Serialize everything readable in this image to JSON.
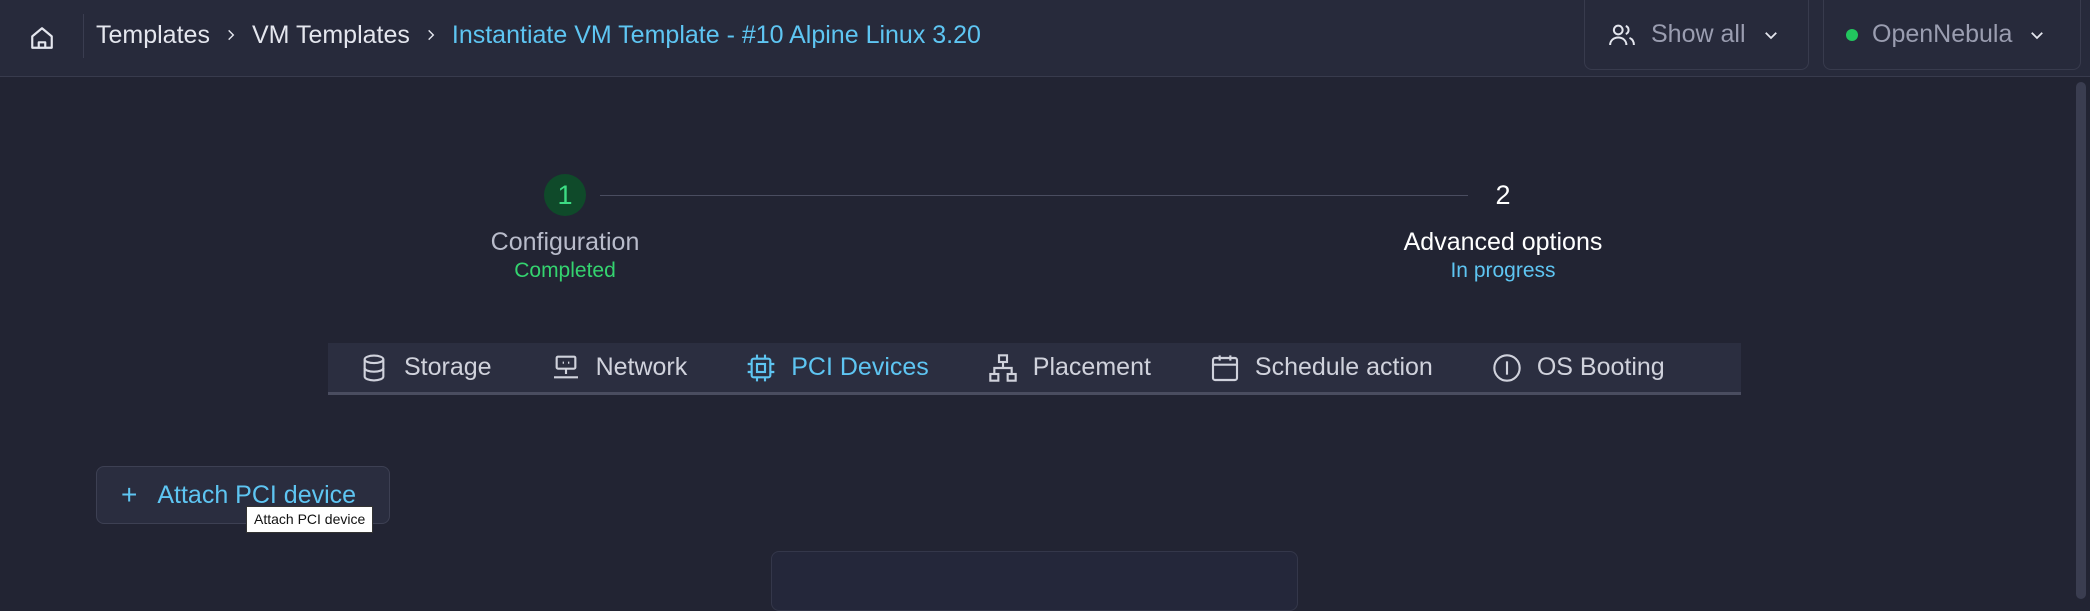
{
  "breadcrumb": {
    "items": [
      "Templates",
      "VM Templates"
    ],
    "current": "Instantiate VM Template - #10 Alpine Linux 3.20"
  },
  "header": {
    "group_filter": "Show all",
    "zone": "OpenNebula",
    "zone_status_color": "#22c55e"
  },
  "stepper": {
    "steps": [
      {
        "number": "1",
        "title": "Configuration",
        "status": "Completed"
      },
      {
        "number": "2",
        "title": "Advanced options",
        "status": "In progress"
      }
    ]
  },
  "tabs": [
    {
      "label": "Storage",
      "icon": "database-icon"
    },
    {
      "label": "Network",
      "icon": "network-icon"
    },
    {
      "label": "PCI Devices",
      "icon": "chip-icon",
      "active": true
    },
    {
      "label": "Placement",
      "icon": "hierarchy-icon"
    },
    {
      "label": "Schedule action",
      "icon": "calendar-icon"
    },
    {
      "label": "OS Booting",
      "icon": "info-circle-icon"
    }
  ],
  "actions": {
    "attach_label": "Attach PCI device",
    "attach_tooltip": "Attach PCI device"
  },
  "colors": {
    "accent": "#5ec5f2",
    "success": "#34d36f",
    "background": "#222433"
  }
}
